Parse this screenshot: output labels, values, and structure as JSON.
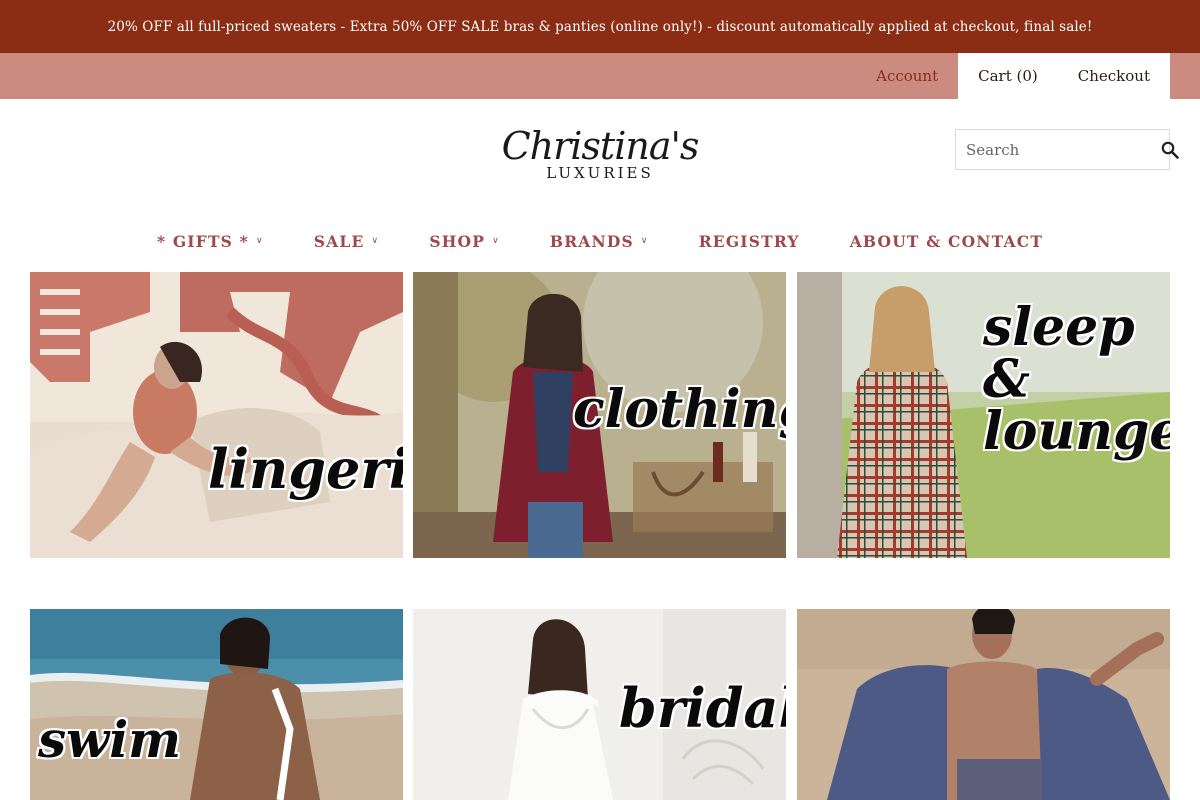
{
  "promo": {
    "text": "20% OFF all full-priced sweaters - Extra 50% OFF SALE bras & panties (online only!) - discount automatically applied at checkout, final sale!"
  },
  "utility_nav": {
    "account": "Account",
    "cart": "Cart (0)",
    "checkout": "Checkout"
  },
  "logo": {
    "script": "Christina's",
    "sub": "LUXURIES"
  },
  "search": {
    "placeholder": "Search",
    "icon": "search-icon"
  },
  "main_nav": {
    "items": [
      {
        "label": "* GIFTS *",
        "dropdown": true
      },
      {
        "label": "SALE",
        "dropdown": true
      },
      {
        "label": "SHOP",
        "dropdown": true
      },
      {
        "label": "BRANDS",
        "dropdown": true
      },
      {
        "label": "REGISTRY",
        "dropdown": false
      },
      {
        "label": "ABOUT & CONTACT",
        "dropdown": false
      }
    ]
  },
  "tiles": [
    {
      "label": "lingerie"
    },
    {
      "label": "clothing"
    },
    {
      "label": "sleep & lounge"
    },
    {
      "label": "swim"
    },
    {
      "label": "bridal"
    },
    {
      "label": ""
    }
  ],
  "colors": {
    "promo_bg": "#8a2d14",
    "util_bg": "#cc8b80",
    "nav_text": "#a0474a"
  }
}
